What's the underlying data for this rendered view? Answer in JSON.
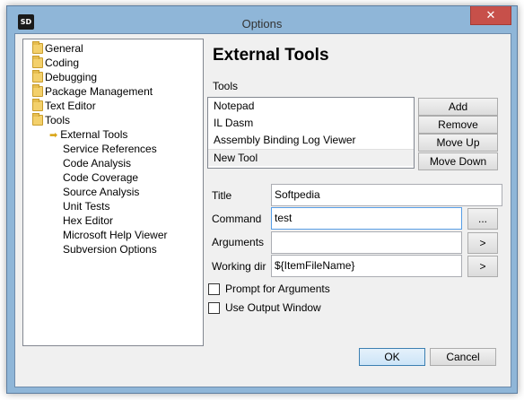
{
  "window": {
    "title": "Options",
    "close_glyph": "✕",
    "app_icon_text": "SD"
  },
  "tree": {
    "items": [
      {
        "label": "General",
        "type": "folder"
      },
      {
        "label": "Coding",
        "type": "folder"
      },
      {
        "label": "Debugging",
        "type": "folder"
      },
      {
        "label": "Package Management",
        "type": "folder"
      },
      {
        "label": "Text Editor",
        "type": "folder"
      },
      {
        "label": "Tools",
        "type": "folder"
      },
      {
        "label": "External Tools",
        "type": "selected-child"
      },
      {
        "label": "Service References",
        "type": "child"
      },
      {
        "label": "Code Analysis",
        "type": "child"
      },
      {
        "label": "Code Coverage",
        "type": "child"
      },
      {
        "label": "Source Analysis",
        "type": "child"
      },
      {
        "label": "Unit Tests",
        "type": "child"
      },
      {
        "label": "Hex Editor",
        "type": "child"
      },
      {
        "label": "Microsoft Help Viewer",
        "type": "child"
      },
      {
        "label": "Subversion Options",
        "type": "child"
      }
    ],
    "selected_marker": "➡"
  },
  "panel": {
    "title": "External Tools",
    "tools_label": "Tools",
    "tools": [
      "Notepad",
      "IL Dasm",
      "Assembly Binding Log Viewer",
      "New Tool"
    ],
    "selected_tool": "New Tool",
    "buttons": {
      "add": "Add",
      "remove": "Remove",
      "move_up": "Move Up",
      "move_down": "Move Down"
    },
    "fields": {
      "title_label": "Title",
      "title_value": "Softpedia",
      "command_label": "Command",
      "command_value": "test",
      "command_browse": "...",
      "arguments_label": "Arguments",
      "arguments_value": "",
      "arguments_menu": ">",
      "working_dir_label": "Working dir",
      "working_dir_value": "${ItemFileName}",
      "working_dir_menu": ">"
    },
    "checkboxes": {
      "prompt_label": "Prompt for Arguments",
      "prompt_checked": false,
      "output_label": "Use Output Window",
      "output_checked": false
    }
  },
  "dialog": {
    "ok": "OK",
    "cancel": "Cancel"
  }
}
